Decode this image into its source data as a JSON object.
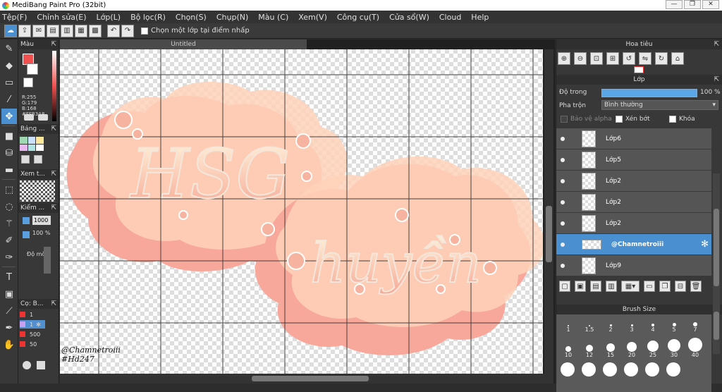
{
  "app": {
    "title": "MediBang Paint Pro (32bit)"
  },
  "window_buttons": [
    "—",
    "❐",
    "✕"
  ],
  "menu": [
    "Tệp(F)",
    "Chỉnh sửa(E)",
    "Lớp(L)",
    "Bộ lọc(R)",
    "Chọn(S)",
    "Chụp(N)",
    "Màu (C)",
    "Xem(V)",
    "Công cụ(T)",
    "Cửa sổ(W)",
    "Cloud",
    "Help"
  ],
  "toolbar": {
    "option_label": "Chọn một lớp tại điểm nhấp"
  },
  "canvas": {
    "tab_title": "Untitled",
    "watermark_line1": "@Chamnetroiii",
    "watermark_line2": "#Hd247",
    "art_text1": "HSG",
    "art_text2": "huyền"
  },
  "color_panel": {
    "title": "Màu",
    "r": "R:255",
    "g": "G:179",
    "b": "B:168",
    "hex": "#FFB3A8",
    "primary_color": "#f05050"
  },
  "palette_panel": {
    "title": "Bảng ..."
  },
  "navigator_small": {
    "title": "Xem t..."
  },
  "check_panel": {
    "title": "Kiểm ...",
    "size_value": "1000",
    "percent_value": "100 %",
    "label": "Độ mờ"
  },
  "brush_list_panel": {
    "title": "Cọ: B...",
    "items": [
      "1",
      "1",
      "500",
      "50"
    ]
  },
  "navigator": {
    "title": "Hoa tiêu"
  },
  "layer_panel": {
    "title": "Lớp",
    "opacity_label": "Độ trong",
    "opacity_value": "100 %",
    "blend_label": "Pha trộn",
    "blend_value": "Bình thường",
    "protect_alpha": "Bảo vệ alpha",
    "clip": "Xén bớt",
    "lock": "Khóa",
    "layers": [
      {
        "name": "Lớp6",
        "selected": false
      },
      {
        "name": "Lớp5",
        "selected": false
      },
      {
        "name": "Lớp2",
        "selected": false
      },
      {
        "name": "Lớp2",
        "selected": false
      },
      {
        "name": "Lớp2",
        "selected": false
      },
      {
        "name": "@Chamnetroiii",
        "selected": true
      },
      {
        "name": "Lớp9",
        "selected": false
      }
    ]
  },
  "brush_size_panel": {
    "title": "Brush Size",
    "row1": [
      "1",
      "1.5",
      "2",
      "3",
      "4",
      "5",
      "7"
    ],
    "row2": [
      "10",
      "12",
      "15",
      "20",
      "25",
      "30",
      "40"
    ]
  }
}
